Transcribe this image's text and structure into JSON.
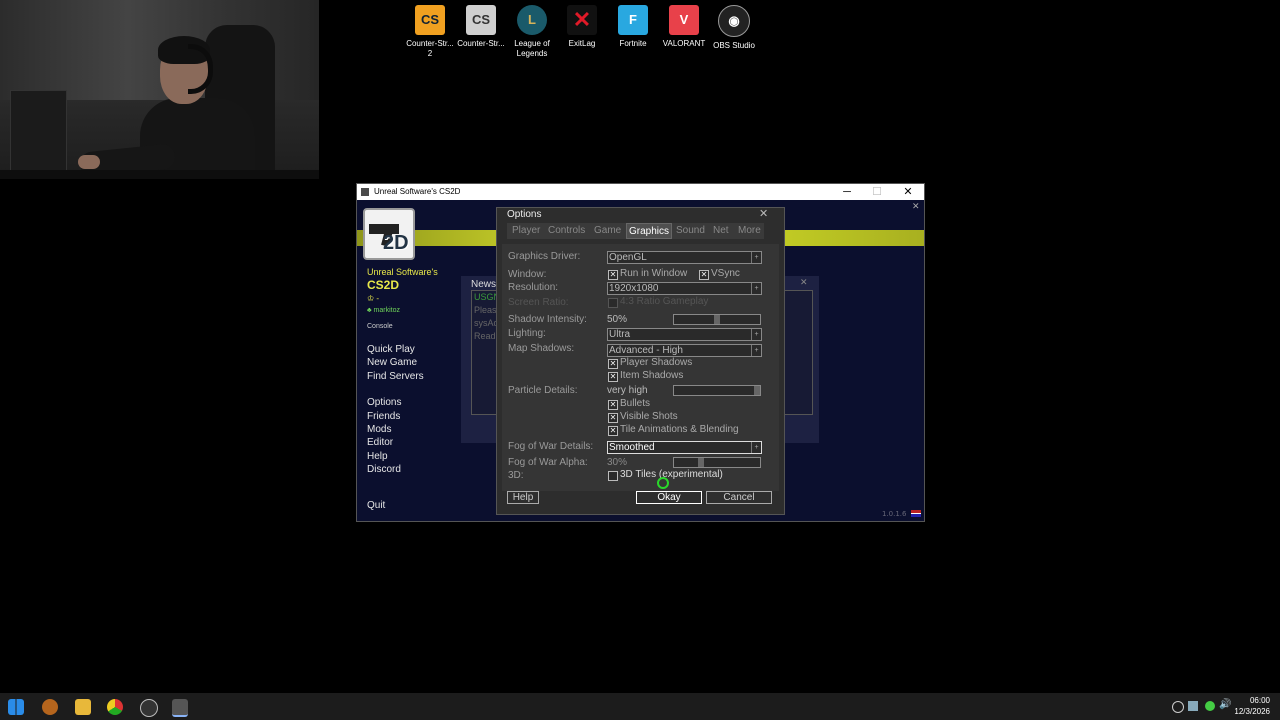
{
  "desktop": {
    "icons": [
      {
        "label_l1": "Counter-Str...",
        "label_l2": "2",
        "icon": "cs2-icon",
        "color": "#f0a020"
      },
      {
        "label_l1": "Counter-Str...",
        "label_l2": "",
        "icon": "csgo-icon",
        "color": "#cfcfcf"
      },
      {
        "label_l1": "League of",
        "label_l2": "Legends",
        "icon": "lol-icon",
        "color": "#1a5a6a"
      },
      {
        "label_l1": "ExitLag",
        "label_l2": "",
        "icon": "exitlag-icon",
        "color": "#c0121e"
      },
      {
        "label_l1": "Fortnite",
        "label_l2": "",
        "icon": "fortnite-icon",
        "color": "#29a8e0"
      },
      {
        "label_l1": "VALORANT",
        "label_l2": "",
        "icon": "valorant-icon",
        "color": "#e8414a"
      },
      {
        "label_l1": "OBS Studio",
        "label_l2": "",
        "icon": "obs-icon",
        "color": "#222222"
      }
    ]
  },
  "window": {
    "title": "Unreal Software's CS2D",
    "controls": {
      "minimize": "─",
      "maximize": "☐",
      "close": "✕"
    },
    "inner_close": "✕",
    "logo_text": "2D",
    "sidebar": {
      "brand": "Unreal Software's",
      "game": "CS2D",
      "user_prefix": "-",
      "username": "markitoz",
      "console": "Console",
      "menu": [
        "Quick Play",
        "New Game",
        "Find Servers",
        "Options",
        "Friends",
        "Mods",
        "Editor",
        "Help",
        "Discord"
      ],
      "quit": "Quit"
    },
    "news": {
      "title": "News",
      "close": "✕",
      "lines": [
        "USGN",
        "Pleas",
        "sysAd",
        "Read"
      ]
    },
    "version": "1.0.1.6"
  },
  "options": {
    "title": "Options",
    "close": "✕",
    "tabs": [
      "Player",
      "Controls",
      "Game",
      "Graphics",
      "Sound",
      "Net",
      "More"
    ],
    "selected_tab": "Graphics",
    "graphics_driver": {
      "label": "Graphics Driver:",
      "value": "OpenGL"
    },
    "window": {
      "label": "Window:",
      "run_in_window": "Run in Window",
      "vsync": "VSync"
    },
    "resolution": {
      "label": "Resolution:",
      "value": "1920x1080"
    },
    "screen_ratio": {
      "label": "Screen Ratio:",
      "value": "4:3 Ratio Gameplay"
    },
    "shadow_intensity": {
      "label": "Shadow Intensity:",
      "value": "50%",
      "level": 0.5
    },
    "lighting": {
      "label": "Lighting:",
      "value": "Ultra"
    },
    "map_shadows": {
      "label": "Map Shadows:",
      "value": "Advanced - High",
      "player_shadows": "Player Shadows",
      "item_shadows": "Item Shadows"
    },
    "particle_details": {
      "label": "Particle Details:",
      "value": "very high",
      "level": 1.0,
      "bullets": "Bullets",
      "visible_shots": "Visible Shots",
      "tile_anim": "Tile Animations & Blending"
    },
    "fog_details": {
      "label": "Fog of War Details:",
      "value": "Smoothed"
    },
    "fog_alpha": {
      "label": "Fog of War Alpha:",
      "value": "30%",
      "level": 0.3
    },
    "three_d": {
      "label": "3D:",
      "value": "3D Tiles (experimental)"
    },
    "buttons": {
      "help": "Help",
      "okay": "Okay",
      "cancel": "Cancel"
    },
    "check_mark": "✕"
  },
  "taskbar": {
    "time": "06:00",
    "date": "12/3/2026",
    "apps": [
      "windows-start-icon",
      "app-icon",
      "file-explorer-icon",
      "chrome-icon",
      "obs-icon",
      "cs2d-icon"
    ]
  }
}
